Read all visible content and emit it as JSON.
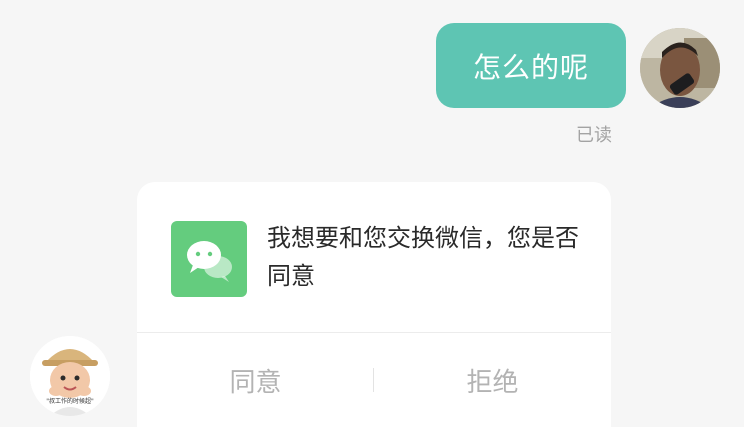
{
  "chat": {
    "outgoing_message": "怎么的呢",
    "read_status": "已读"
  },
  "request_card": {
    "icon": "wechat-icon",
    "message": "我想要和您交换微信，您是否同意",
    "agree_label": "同意",
    "refuse_label": "拒绝"
  },
  "avatars": {
    "me": "user-avatar",
    "them": "contact-avatar",
    "them_caption": "\"叔工作的时候超\""
  },
  "colors": {
    "bubble": "#5ec5b3",
    "wechat_green": "#64cc7e",
    "background": "#f6f6f6"
  }
}
